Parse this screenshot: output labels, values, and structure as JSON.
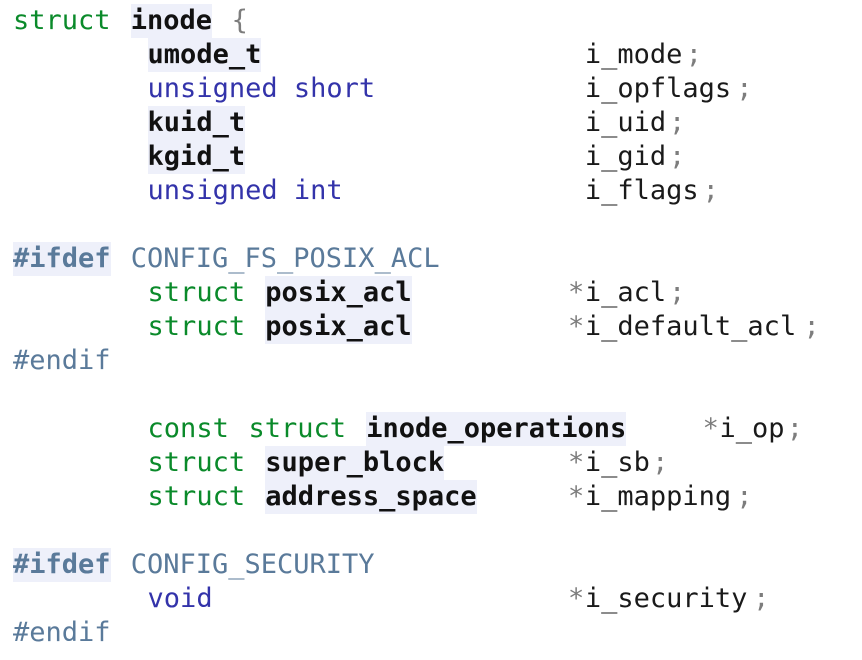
{
  "document": {
    "kind": "source-code-listing",
    "language": "C",
    "background_color": "#ffffff",
    "colors": {
      "keyword": "#0a8a2a",
      "builtin_type": "#3333aa",
      "type_name": "#111111",
      "type_name_highlight": "#eef0fa",
      "identifier": "#1a1a1a",
      "punctuation": "#7d7d7d",
      "preprocessor": "#5a7a9a",
      "preprocessor_highlight": "#eef0fa"
    }
  },
  "lines": [
    {
      "n": 1,
      "text": "struct inode {",
      "tokens": [
        {
          "t": "struct",
          "k": "keyword",
          "col": 0
        },
        {
          "t": "inode",
          "k": "typename",
          "col": 7
        },
        {
          "t": "{",
          "k": "punct",
          "col": 13
        }
      ]
    },
    {
      "n": 2,
      "text": "        umode_t                 i_mode;",
      "tokens": [
        {
          "t": "umode_t",
          "k": "typename",
          "col": 8
        },
        {
          "t": "i_mode",
          "k": "ident",
          "col": 34
        },
        {
          "t": ";",
          "k": "punct",
          "col": 40
        }
      ]
    },
    {
      "n": 3,
      "text": "        unsigned short          i_opflags;",
      "tokens": [
        {
          "t": "unsigned short",
          "k": "builtin",
          "col": 8
        },
        {
          "t": "i_opflags",
          "k": "ident",
          "col": 34
        },
        {
          "t": ";",
          "k": "punct",
          "col": 43
        }
      ]
    },
    {
      "n": 4,
      "text": "        kuid_t                  i_uid;",
      "tokens": [
        {
          "t": "kuid_t",
          "k": "typename",
          "col": 8
        },
        {
          "t": "i_uid",
          "k": "ident",
          "col": 34
        },
        {
          "t": ";",
          "k": "punct",
          "col": 39
        }
      ]
    },
    {
      "n": 5,
      "text": "        kgid_t                  i_gid;",
      "tokens": [
        {
          "t": "kgid_t",
          "k": "typename",
          "col": 8
        },
        {
          "t": "i_gid",
          "k": "ident",
          "col": 34
        },
        {
          "t": ";",
          "k": "punct",
          "col": 39
        }
      ]
    },
    {
      "n": 6,
      "text": "        unsigned int            i_flags;",
      "tokens": [
        {
          "t": "unsigned int",
          "k": "builtin",
          "col": 8
        },
        {
          "t": "i_flags",
          "k": "ident",
          "col": 34
        },
        {
          "t": ";",
          "k": "punct",
          "col": 41
        }
      ]
    },
    {
      "n": 7,
      "text": "",
      "tokens": []
    },
    {
      "n": 8,
      "text": "#ifdef CONFIG_FS_POSIX_ACL",
      "tokens": [
        {
          "t": "#ifdef",
          "k": "prepro-kw",
          "col": 0
        },
        {
          "t": "CONFIG_FS_POSIX_ACL",
          "k": "prepro",
          "col": 7
        }
      ]
    },
    {
      "n": 9,
      "text": "        struct posix_acl        *i_acl;",
      "tokens": [
        {
          "t": "struct",
          "k": "keyword",
          "col": 8
        },
        {
          "t": "posix_acl",
          "k": "typename",
          "col": 15
        },
        {
          "t": "*",
          "k": "punct",
          "col": 33
        },
        {
          "t": "i_acl",
          "k": "ident",
          "col": 34
        },
        {
          "t": ";",
          "k": "punct",
          "col": 39
        }
      ]
    },
    {
      "n": 10,
      "text": "        struct posix_acl        *i_default_acl;",
      "tokens": [
        {
          "t": "struct",
          "k": "keyword",
          "col": 8
        },
        {
          "t": "posix_acl",
          "k": "typename",
          "col": 15
        },
        {
          "t": "*",
          "k": "punct",
          "col": 33
        },
        {
          "t": "i_default_acl",
          "k": "ident",
          "col": 34
        },
        {
          "t": ";",
          "k": "punct",
          "col": 47
        }
      ]
    },
    {
      "n": 11,
      "text": "#endif",
      "tokens": [
        {
          "t": "#endif",
          "k": "prepro",
          "col": 0
        }
      ]
    },
    {
      "n": 12,
      "text": "",
      "tokens": []
    },
    {
      "n": 13,
      "text": "        const struct inode_operations   *i_op;",
      "tokens": [
        {
          "t": "const",
          "k": "keyword",
          "col": 8
        },
        {
          "t": "struct",
          "k": "keyword",
          "col": 14
        },
        {
          "t": "inode_operations",
          "k": "typename",
          "col": 21
        },
        {
          "t": "*",
          "k": "punct",
          "col": 41
        },
        {
          "t": "i_op",
          "k": "ident",
          "col": 42
        },
        {
          "t": ";",
          "k": "punct",
          "col": 46
        }
      ]
    },
    {
      "n": 14,
      "text": "        struct super_block      *i_sb;",
      "tokens": [
        {
          "t": "struct",
          "k": "keyword",
          "col": 8
        },
        {
          "t": "super_block",
          "k": "typename",
          "col": 15
        },
        {
          "t": "*",
          "k": "punct",
          "col": 33
        },
        {
          "t": "i_sb",
          "k": "ident",
          "col": 34
        },
        {
          "t": ";",
          "k": "punct",
          "col": 38
        }
      ]
    },
    {
      "n": 15,
      "text": "        struct address_space    *i_mapping;",
      "tokens": [
        {
          "t": "struct",
          "k": "keyword",
          "col": 8
        },
        {
          "t": "address_space",
          "k": "typename",
          "col": 15
        },
        {
          "t": "*",
          "k": "punct",
          "col": 33
        },
        {
          "t": "i_mapping",
          "k": "ident",
          "col": 34
        },
        {
          "t": ";",
          "k": "punct",
          "col": 43
        }
      ]
    },
    {
      "n": 16,
      "text": "",
      "tokens": []
    },
    {
      "n": 17,
      "text": "#ifdef CONFIG_SECURITY",
      "tokens": [
        {
          "t": "#ifdef",
          "k": "prepro-kw",
          "col": 0
        },
        {
          "t": "CONFIG_SECURITY",
          "k": "prepro",
          "col": 7
        }
      ]
    },
    {
      "n": 18,
      "text": "        void                    *i_security;",
      "tokens": [
        {
          "t": "void",
          "k": "builtin",
          "col": 8
        },
        {
          "t": "*",
          "k": "punct",
          "col": 33
        },
        {
          "t": "i_security",
          "k": "ident",
          "col": 34
        },
        {
          "t": ";",
          "k": "punct",
          "col": 44
        }
      ]
    },
    {
      "n": 19,
      "text": "#endif",
      "tokens": [
        {
          "t": "#endif",
          "k": "prepro",
          "col": 0
        }
      ]
    }
  ]
}
